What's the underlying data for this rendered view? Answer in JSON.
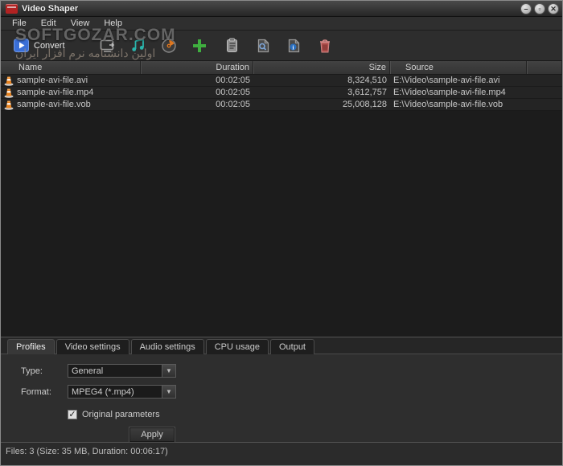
{
  "window": {
    "title": "Video Shaper",
    "controls": {
      "minimize": "–",
      "maximize": "▫",
      "close": "✕"
    }
  },
  "menu": {
    "items": [
      {
        "label": "File"
      },
      {
        "label": "Edit"
      },
      {
        "label": "View"
      },
      {
        "label": "Help"
      }
    ]
  },
  "toolbar": {
    "convert_label": "Convert",
    "icons": [
      {
        "name": "convert-icon",
        "color": "#3a6fd8"
      },
      {
        "name": "preview-screen-icon",
        "color": "#9a9a9a"
      },
      {
        "name": "audio-notes-icon",
        "color": "#2ab5ac"
      },
      {
        "name": "disc-icon",
        "color": "#e07820"
      },
      {
        "name": "add-file-icon",
        "color": "#3fae3f"
      },
      {
        "name": "paste-icon",
        "color": "#9a9a9a"
      },
      {
        "name": "search-file-icon",
        "color": "#9a9a9a"
      },
      {
        "name": "file-info-icon",
        "color": "#2a6fc0"
      },
      {
        "name": "delete-icon",
        "color": "#c0504d"
      }
    ]
  },
  "watermark": {
    "line1": "SOFTGOZAR.COM",
    "line2": "اولین دانشنامه نرم افزار ایران"
  },
  "table": {
    "columns": [
      "Name",
      "Duration",
      "Size",
      "Source"
    ],
    "rows": [
      {
        "name": "sample-avi-file.avi",
        "duration": "00:02:05",
        "size": "8,324,510",
        "source": "E:\\Video\\sample-avi-file.avi"
      },
      {
        "name": "sample-avi-file.mp4",
        "duration": "00:02:05",
        "size": "3,612,757",
        "source": "E:\\Video\\sample-avi-file.mp4"
      },
      {
        "name": "sample-avi-file.vob",
        "duration": "00:02:05",
        "size": "25,008,128",
        "source": "E:\\Video\\sample-avi-file.vob"
      }
    ]
  },
  "tabs": {
    "items": [
      {
        "label": "Profiles",
        "active": true
      },
      {
        "label": "Video settings",
        "active": false
      },
      {
        "label": "Audio settings",
        "active": false
      },
      {
        "label": "CPU usage",
        "active": false
      },
      {
        "label": "Output",
        "active": false
      }
    ]
  },
  "profiles_panel": {
    "type_label": "Type:",
    "type_value": "General",
    "format_label": "Format:",
    "format_value": "MPEG4 (*.mp4)",
    "checkbox_label": "Original parameters",
    "checkbox_checked": "✓",
    "apply_label": "Apply"
  },
  "status_bar": {
    "text": "Files: 3 (Size: 35 MB, Duration: 00:06:17)"
  },
  "colors": {
    "window_bg": "#2b2b2b",
    "list_bg": "#1c1c1c",
    "row_bg": "#242424",
    "accent_convert": "#3a6fd8",
    "accent_add": "#3fae3f",
    "accent_delete": "#c0504d",
    "accent_music": "#2ab5ac",
    "accent_disc": "#e07820",
    "cone_orange": "#e8821e"
  }
}
